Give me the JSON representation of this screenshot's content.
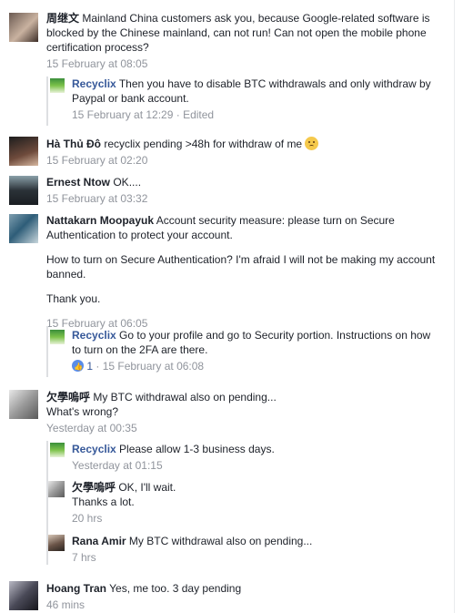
{
  "comments": [
    {
      "name": "周继文",
      "text": " Mainland China customers ask you, because Google-related software is blocked by the Chinese mainland, can not run! Can not open the mobile phone certification process?",
      "time": "15 February at 08:05",
      "reply": {
        "name": "Recyclix",
        "text": " Then you have to disable BTC withdrawals and only withdraw by Paypal or bank account.",
        "time": "15 February at 12:29 · Edited"
      }
    },
    {
      "name": "Hà Thủ Đô",
      "text": " recyclix pending >48h for withdraw of me ",
      "emoji": "worried-face-emoji",
      "time": "15 February at 02:20"
    },
    {
      "name": "Ernest Ntow",
      "text": " OK....",
      "time": "15 February at 03:32"
    },
    {
      "name": "Nattakarn Moopayuk",
      "text": " Account security measure: please turn on Secure Authentication to protect your account.",
      "para2": "How to turn on Secure Authentication? I'm afraid I will not be making my account banned.",
      "para3": "Thank you.",
      "time": "15 February at 06:05",
      "reply": {
        "name": "Recyclix",
        "text": " Go to your profile and go to Security portion. Instructions on how to turn on the 2FA are there.",
        "likes": "1",
        "time": " · 15 February at 06:08"
      }
    },
    {
      "name": "欠學嗚呼",
      "text": " My BTC withdrawal also on pending...",
      "line2": "What's wrong?",
      "time": "Yesterday at 00:35",
      "replies": [
        {
          "name": "Recyclix",
          "text": " Please allow 1-3 business days.",
          "time": "Yesterday at 01:15"
        },
        {
          "name": "欠學嗚呼",
          "text": " OK, I'll wait.",
          "line2": "Thanks a lot.",
          "time": "20 hrs"
        },
        {
          "name": "Rana Amir",
          "text": " My BTC withdrawal also on pending...",
          "time": "7 hrs"
        }
      ]
    },
    {
      "name": "Hoang Tran",
      "text": " Yes, me too. 3 day pending",
      "time": "46 mins"
    }
  ],
  "colors": {
    "link": "#365899",
    "meta": "#90949c",
    "like": "#598de8"
  }
}
